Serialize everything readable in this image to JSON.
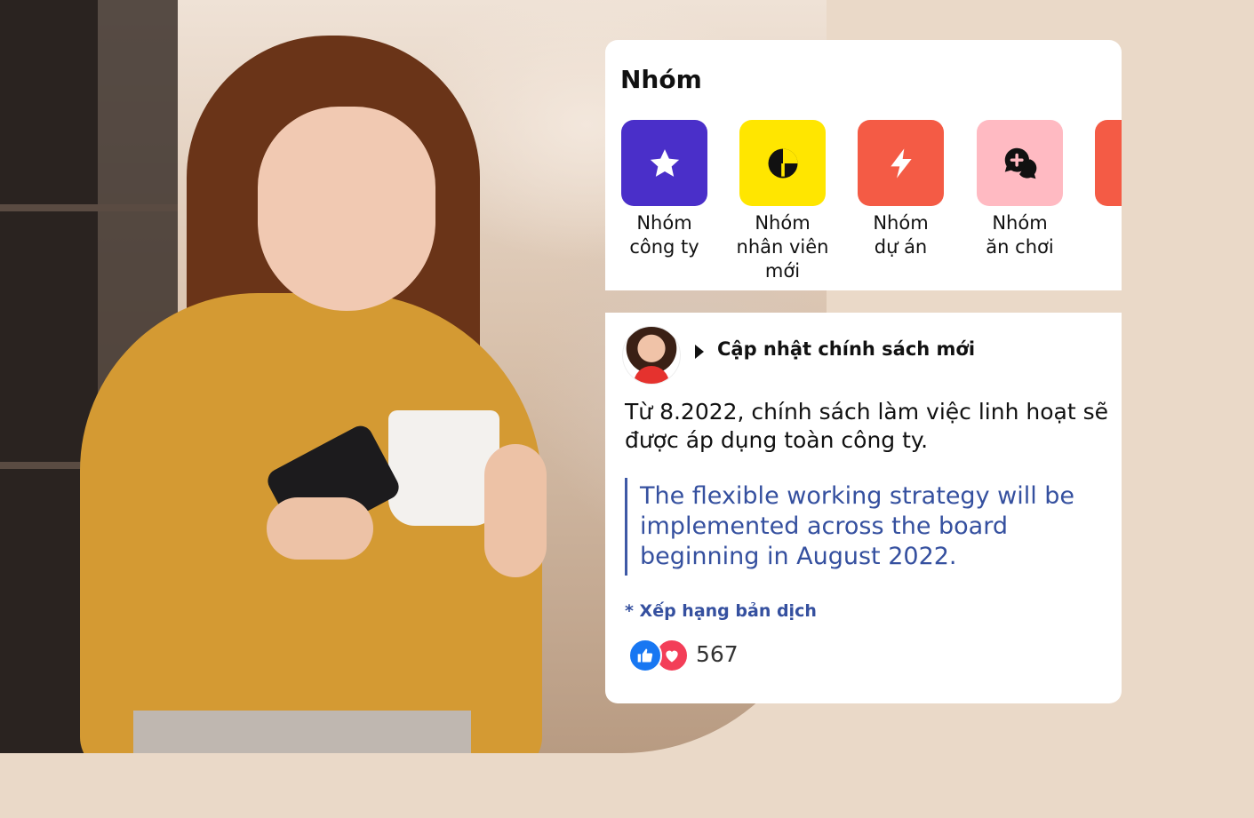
{
  "groups": {
    "title": "Nhóm",
    "items": [
      {
        "label_line1": "Nhóm",
        "label_line2": "công ty",
        "label_line3": "",
        "color": "#4a2fc9",
        "icon": "star-icon"
      },
      {
        "label_line1": "Nhóm",
        "label_line2": "nhân viên",
        "label_line3": "mới",
        "color": "#ffe600",
        "icon": "pie-chart-icon"
      },
      {
        "label_line1": "Nhóm",
        "label_line2": "dự án",
        "label_line3": "",
        "color": "#f45b45",
        "icon": "lightning-icon"
      },
      {
        "label_line1": "Nhóm",
        "label_line2": "ăn chơi",
        "label_line3": "",
        "color": "#ffbac2",
        "icon": "chat-bubbles-icon"
      },
      {
        "label_line1": "",
        "label_line2": "",
        "label_line3": "",
        "color": "#f45b45",
        "icon": "partial-icon"
      }
    ]
  },
  "post": {
    "title": "Cập nhật chính sách mới",
    "body": "Từ 8.2022, chính sách làm việc linh hoạt sẽ được áp dụng toàn công ty.",
    "translation": "The flexible working strategy will be implemented across the board beginning in August 2022.",
    "rate_label": "* Xếp hạng bản dịch",
    "reaction_count": "567"
  },
  "colors": {
    "page_bg": "#ead9c8",
    "accent_blue": "#35509f",
    "like_blue": "#1877f2",
    "love_red": "#f33e58"
  }
}
